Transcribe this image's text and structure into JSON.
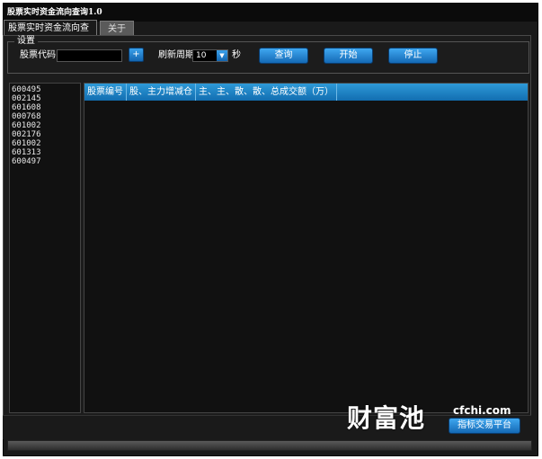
{
  "window": {
    "title": "股票实时资金流向查询1.0"
  },
  "tabs": [
    {
      "label": "股票实时资金流向查询"
    },
    {
      "label": "关于"
    }
  ],
  "settings": {
    "legend": "设置",
    "stock_code_label": "股票代码",
    "stock_code_value": "",
    "add_label": "+",
    "refresh_label": "刷新周期",
    "refresh_value": "10",
    "seconds_label": "秒",
    "query_label": "查询",
    "start_label": "开始",
    "stop_label": "停止"
  },
  "stock_list": [
    "600495",
    "002145",
    "601608",
    "000768",
    "601002",
    "002176",
    "601002",
    "601313",
    "600497"
  ],
  "grid": {
    "columns": [
      "股票编号",
      "股、主力增减仓",
      "主、主、散、散、总成交额（万）"
    ]
  },
  "watermark": {
    "text": "财富池",
    "site": "cfchi.com",
    "platform": "指标交易平台"
  },
  "colors": {
    "accent": "#1e88d0",
    "background": "#1a1a1a"
  }
}
